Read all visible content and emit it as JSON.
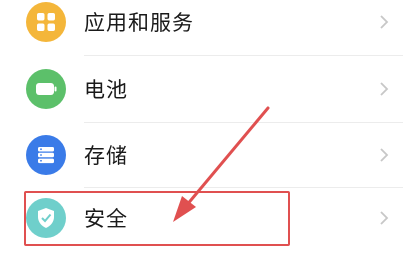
{
  "items": [
    {
      "label": "应用和服务",
      "icon": "apps-grid-icon",
      "color": "#f4b63a"
    },
    {
      "label": "电池",
      "icon": "battery-icon",
      "color": "#5cc06a"
    },
    {
      "label": "存储",
      "icon": "storage-icon",
      "color": "#3a7be8"
    },
    {
      "label": "安全",
      "icon": "shield-check-icon",
      "color": "#6fcfcb"
    }
  ],
  "annotation": {
    "highlight_color": "#e05050"
  }
}
